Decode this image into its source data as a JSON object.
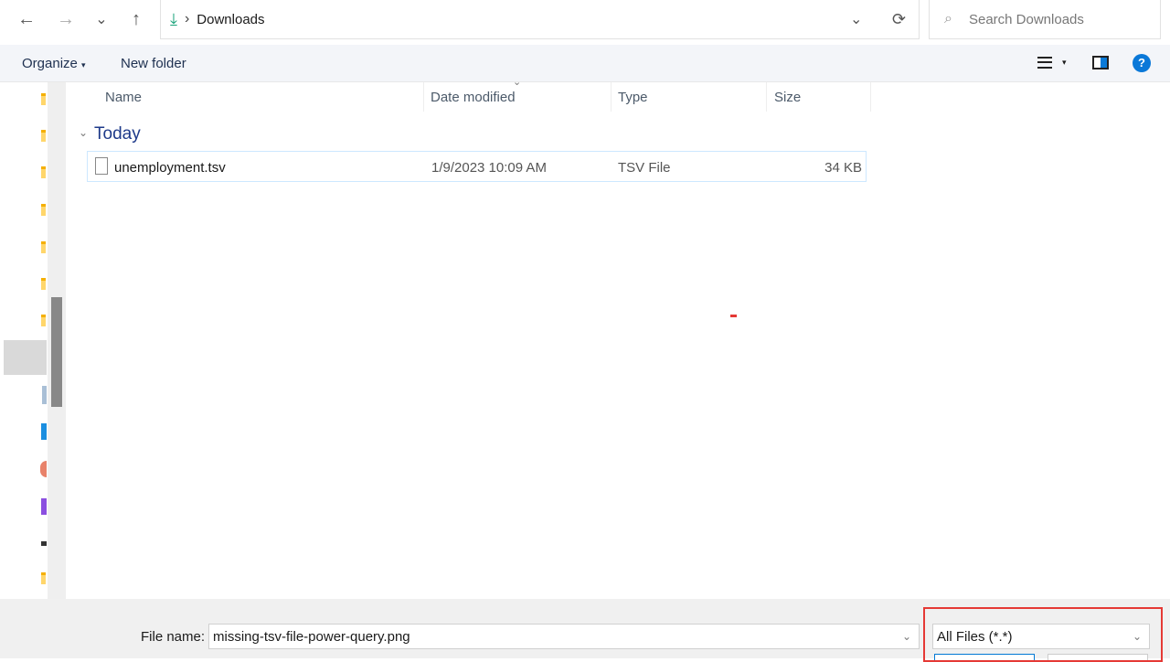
{
  "nav": {
    "back": "←",
    "forward": "→",
    "recent": "⌄",
    "up": "↑"
  },
  "address": {
    "sep": "›",
    "location": "Downloads",
    "refresh": "⟳",
    "dropdown": "⌄"
  },
  "search": {
    "placeholder": "Search Downloads"
  },
  "toolbar": {
    "organize": "Organize",
    "organize_caret": "▾",
    "new_folder": "New folder",
    "help": "?",
    "view_caret": "▾"
  },
  "columns": {
    "name": "Name",
    "date": "Date modified",
    "type": "Type",
    "size": "Size",
    "sort": "⌄"
  },
  "group": {
    "chevron": "⌄",
    "label": "Today"
  },
  "files": [
    {
      "name": "unemployment.tsv",
      "date": "1/9/2023 10:09 AM",
      "type": "TSV File",
      "size": "34 KB"
    }
  ],
  "footer": {
    "file_name_label": "File name:",
    "file_name_value": "missing-tsv-file-power-query.png",
    "file_type": "All Files (*.*)",
    "caret": "⌄"
  },
  "colors": {
    "highlight": "#e53935",
    "accent": "#0078d4"
  }
}
